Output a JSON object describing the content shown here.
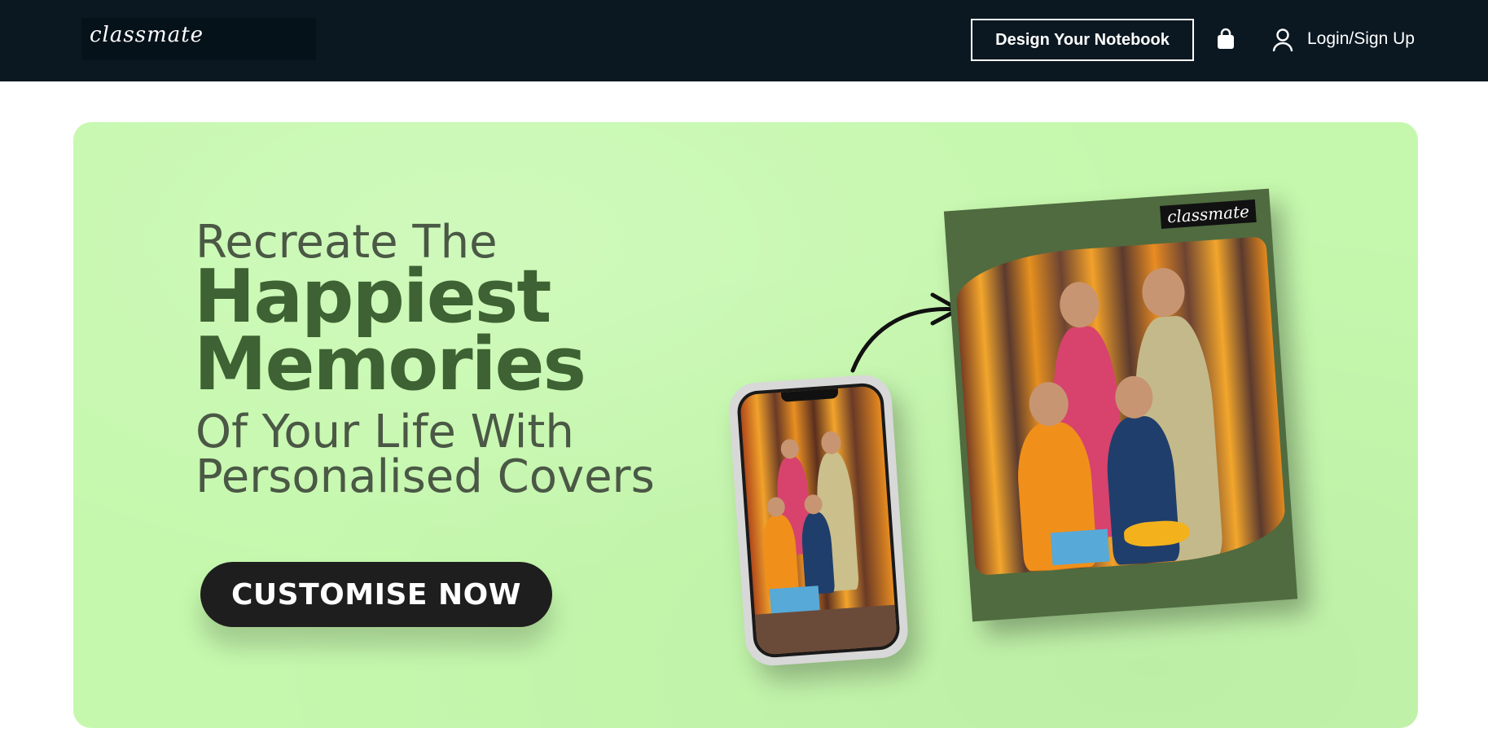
{
  "header": {
    "logo_text": "classmate",
    "design_button_label": "Design Your Notebook",
    "cart_icon": "shopping-bag-icon",
    "user_icon": "user-icon",
    "login_label": "Login/Sign Up"
  },
  "banner": {
    "line1": "Recreate The",
    "line2": "Happiest",
    "line3": "Memories",
    "line4": "Of Your Life With",
    "line5": "Personalised Covers",
    "cta_label": "CUSTOMISE NOW",
    "notebook_logo": "classmate",
    "background_color": "#c5f8ad",
    "headline_color": "#3e6233",
    "cover_color": "#4f6b3f"
  }
}
